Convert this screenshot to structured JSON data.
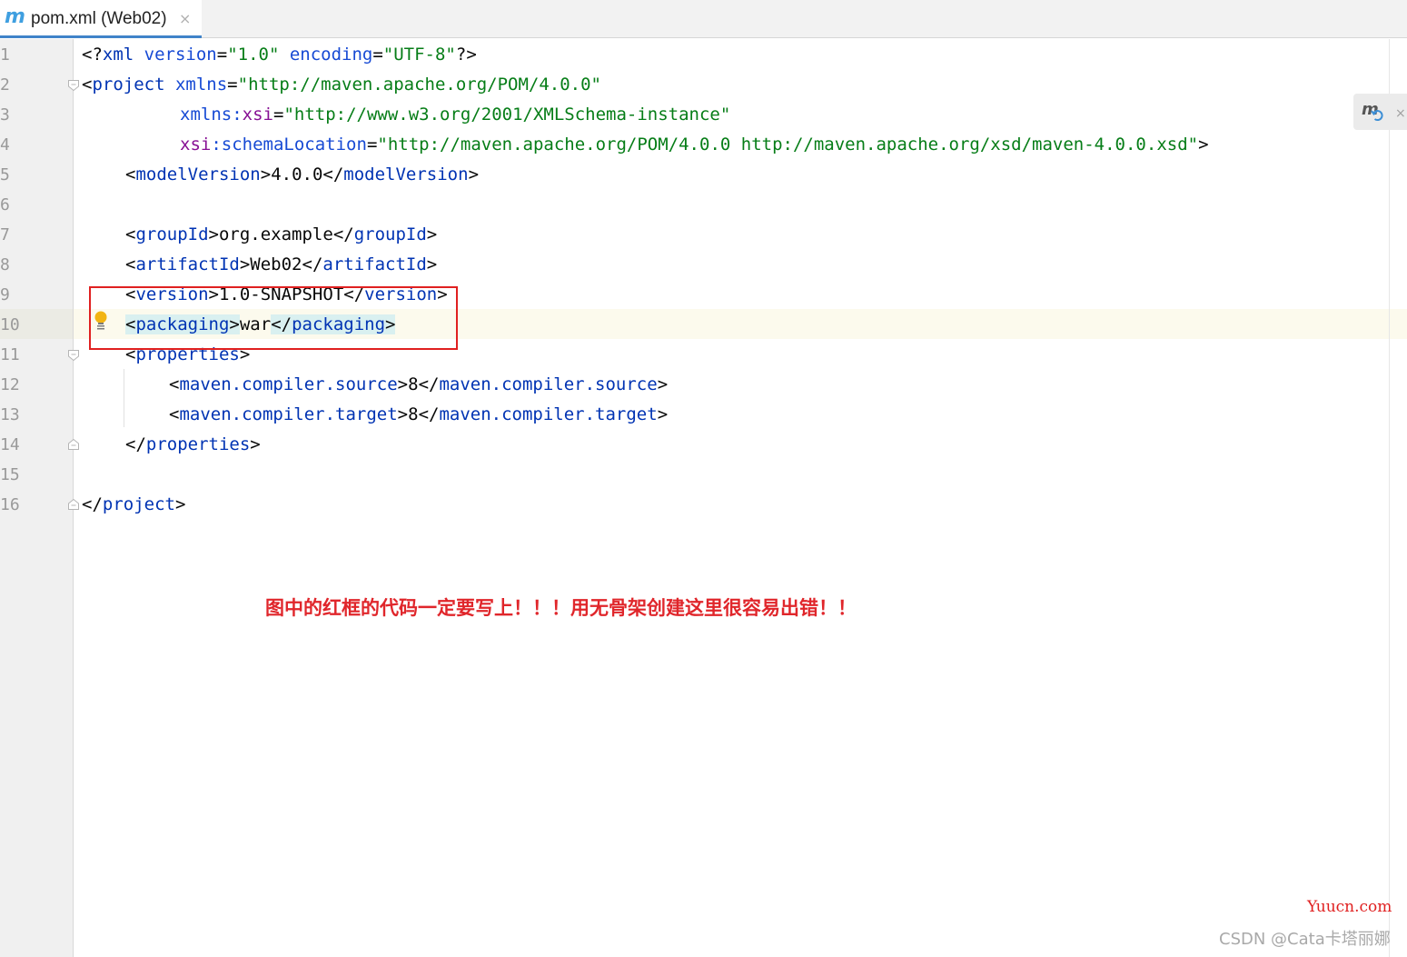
{
  "tab": {
    "icon": "maven-m-icon",
    "label": "pom.xml (Web02)",
    "close": "×"
  },
  "editor": {
    "line_numbers": [
      "1",
      "2",
      "3",
      "4",
      "5",
      "6",
      "7",
      "8",
      "9",
      "10",
      "11",
      "12",
      "13",
      "14",
      "15",
      "16"
    ],
    "lines": {
      "l1": {
        "t0": "<?",
        "t1": "xml",
        "t2": " version",
        "t3": "=",
        "t4": "\"1.0\"",
        "t5": " encoding",
        "t6": "=",
        "t7": "\"UTF-8\"",
        "t8": "?>"
      },
      "l2": {
        "t0": "<",
        "t1": "project",
        "t2": " xmlns",
        "t3": "=",
        "t4": "\"http://maven.apache.org/POM/4.0.0\""
      },
      "l3": {
        "t0": "xmlns",
        "t1": ":",
        "t2": "xsi",
        "t3": "=",
        "t4": "\"http://www.w3.org/2001/XMLSchema-instance\""
      },
      "l4": {
        "t0": "xsi",
        "t1": ":",
        "t2": "schemaLocation",
        "t3": "=",
        "t4": "\"http://maven.apache.org/POM/4.0.0 http://maven.apache.org/xsd/maven-4.0.0.xsd\"",
        "t5": ">"
      },
      "l5": {
        "t0": "<",
        "t1": "modelVersion",
        "t2": ">",
        "t3": "4.0.0",
        "t4": "</",
        "t5": "modelVersion",
        "t6": ">"
      },
      "l7": {
        "t0": "<",
        "t1": "groupId",
        "t2": ">",
        "t3": "org.example",
        "t4": "</",
        "t5": "groupId",
        "t6": ">"
      },
      "l8": {
        "t0": "<",
        "t1": "artifactId",
        "t2": ">",
        "t3": "Web02",
        "t4": "</",
        "t5": "artifactId",
        "t6": ">"
      },
      "l9": {
        "t0": "<",
        "t1": "version",
        "t2": ">",
        "t3": "1.0-SNAPSHOT",
        "t4": "</",
        "t5": "version",
        "t6": ">"
      },
      "l10": {
        "t0": "<",
        "t1": "packaging",
        "t2": ">",
        "t3": "war",
        "t4": "</",
        "t5": "packaging",
        "t6": ">"
      },
      "l11": {
        "t0": "<",
        "t1": "properties",
        "t2": ">"
      },
      "l12": {
        "t0": "<",
        "t1": "maven.compiler.source",
        "t2": ">",
        "t3": "8",
        "t4": "</",
        "t5": "maven.compiler.source",
        "t6": ">"
      },
      "l13": {
        "t0": "<",
        "t1": "maven.compiler.target",
        "t2": ">",
        "t3": "8",
        "t4": "</",
        "t5": "maven.compiler.target",
        "t6": ">"
      },
      "l14": {
        "t0": "</",
        "t1": "properties",
        "t2": ">"
      },
      "l16": {
        "t0": "</",
        "t1": "project",
        "t2": ">"
      }
    },
    "current_line": "10"
  },
  "annotation": {
    "text": "图中的红框的代码一定要写上！！！用无骨架创建这里很容易出错！！"
  },
  "watermarks": {
    "site": "Yuucn.com",
    "csdn": "CSDN @Cata卡塔丽娜"
  },
  "icons": {
    "maven_reload": "maven-reload-icon",
    "intention_bulb": "lightbulb-icon",
    "fold": "fold-marker-icon"
  },
  "colors": {
    "tag": "#0033b3",
    "attribute": "#174ad4",
    "namespace": "#871094",
    "string": "#067d17",
    "annotation_red": "#e0262b",
    "tab_accent": "#4083c9"
  }
}
